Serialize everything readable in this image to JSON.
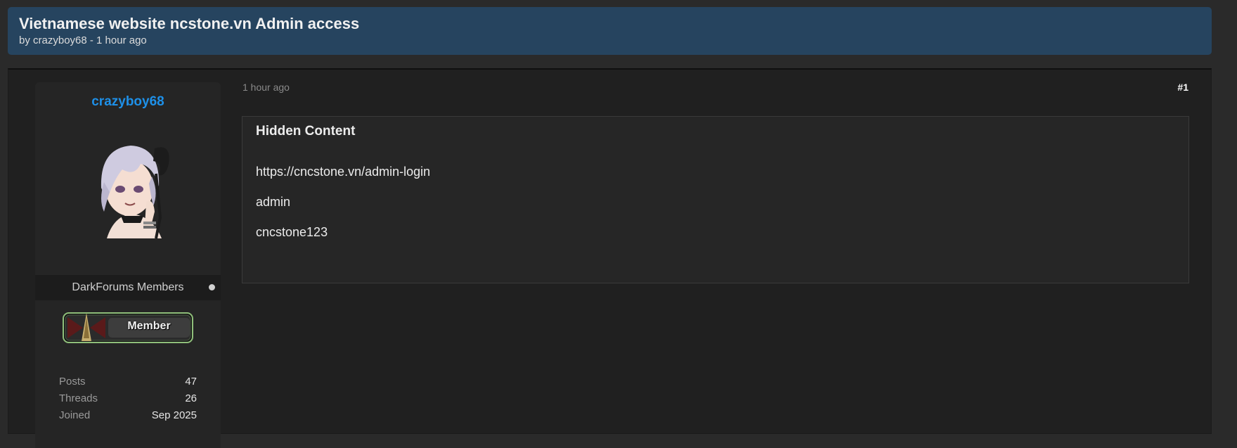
{
  "thread": {
    "title": "Vietnamese website ncstone.vn Admin access",
    "meta": "by crazyboy68 - 1 hour ago"
  },
  "author": {
    "name": "crazyboy68",
    "avatar_alt": "anime-girl-avatar",
    "group": "DarkForums Members",
    "badge_label": "Member",
    "stats": [
      {
        "label": "Posts",
        "value": "47"
      },
      {
        "label": "Threads",
        "value": "26"
      },
      {
        "label": "Joined",
        "value": "Sep 2025"
      }
    ]
  },
  "post": {
    "time": "1 hour ago",
    "number": "#1",
    "content_title": "Hidden Content",
    "lines": [
      "https://cncstone.vn/admin-login",
      "admin",
      "cncstone123"
    ]
  },
  "colors": {
    "header_bg": "#26445f",
    "username": "#1e90e8",
    "page_bg": "#2a2a2a"
  }
}
